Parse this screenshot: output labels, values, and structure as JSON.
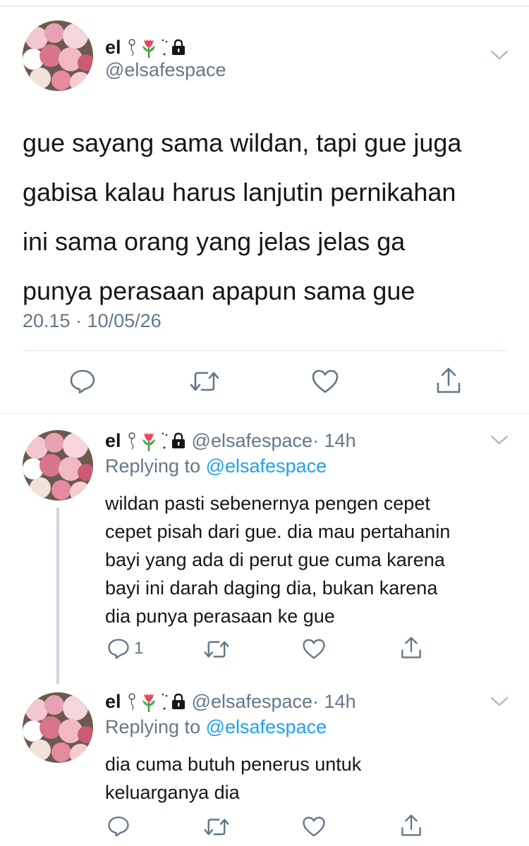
{
  "main_tweet": {
    "display_name": "el",
    "handle": "@elsafespace",
    "text_lines": [
      "gue sayang sama wildan, tapi gue juga",
      "gabisa kalau harus lanjutin pernikahan",
      "ini sama orang yang jelas jelas ga",
      "punya perasaan apapun sama gue"
    ],
    "timestamp": "20.15 · 10/05/26",
    "actions": {
      "reply_icon": "reply-icon",
      "retweet_icon": "retweet-icon",
      "like_icon": "heart-icon",
      "share_icon": "share-icon"
    }
  },
  "replies": [
    {
      "display_name": "el",
      "handle": "@elsafespace",
      "time": "· 14h",
      "replying_prefix": "Replying to",
      "replying_handle": "@elsafespace",
      "text_lines": [
        "wildan pasti sebenernya pengen cepet",
        "cepet pisah dari gue. dia mau pertahanin",
        "bayi yang ada di perut gue cuma karena",
        "bayi ini darah daging dia, bukan karena",
        "dia punya perasaan ke gue"
      ],
      "reply_count": "1"
    },
    {
      "display_name": "el",
      "handle": "@elsafespace",
      "time": "· 14h",
      "replying_prefix": "Replying to",
      "replying_handle": "@elsafespace",
      "text_lines": [
        "dia cuma butuh penerus untuk",
        "keluarganya dia"
      ],
      "reply_count": ""
    }
  ],
  "colors": {
    "text": "#14171a",
    "muted": "#657786",
    "link": "#1da1f2",
    "divider": "#e1e8ed",
    "icon": "#657786"
  }
}
